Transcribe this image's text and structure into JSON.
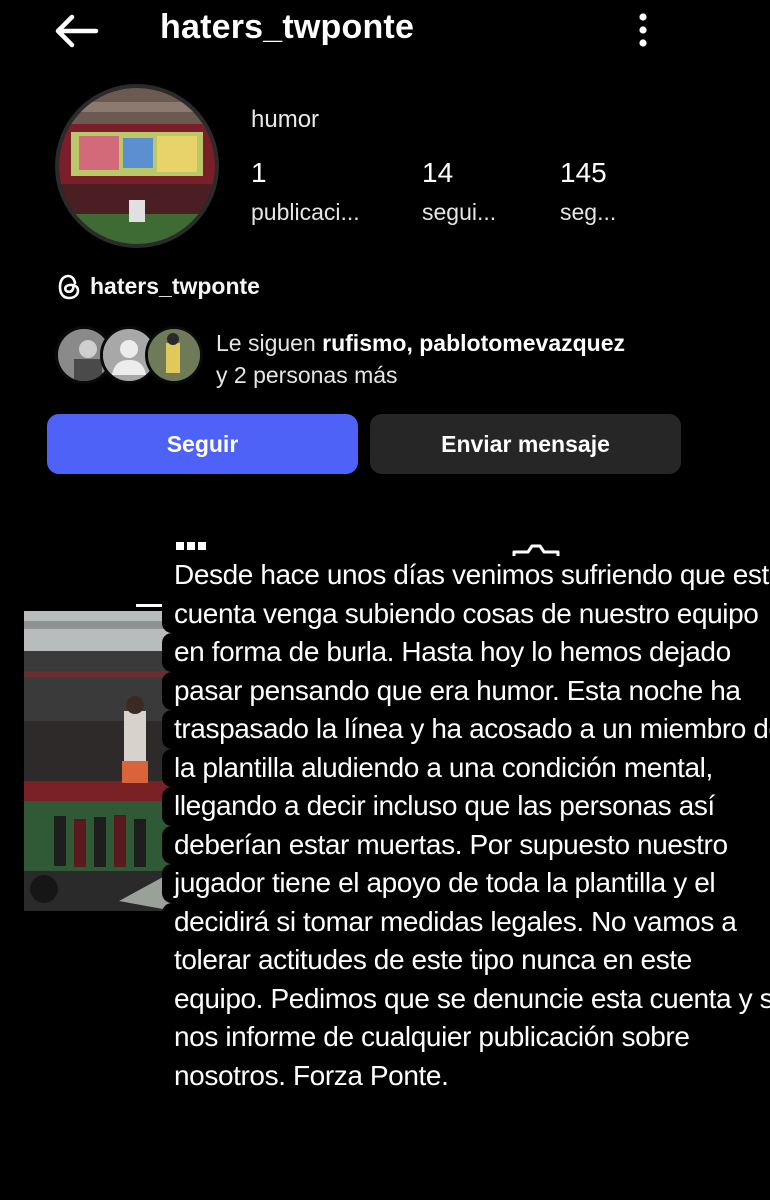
{
  "header": {
    "username": "haters_twponte"
  },
  "profile": {
    "category": "humor",
    "stats": [
      {
        "value": "1",
        "label": "publicaci..."
      },
      {
        "value": "14",
        "label": "segui..."
      },
      {
        "value": "145",
        "label": "seg..."
      }
    ],
    "threads_handle": "haters_twponte"
  },
  "followed_by": {
    "prefix": "Le siguen ",
    "names": "rufismo, pablotomevazquez",
    "suffix": "y 2 personas más"
  },
  "actions": {
    "follow_label": "Seguir",
    "message_label": "Enviar mensaje"
  },
  "overlay_text": {
    "lines": [
      "Desde hace unos días venimos sufriendo que esta",
      "cuenta venga subiendo cosas de nuestro equipo",
      "en forma de burla. Hasta hoy lo hemos dejado",
      "pasar pensando que era humor. Esta noche ha",
      "traspasado la línea y ha acosado a un miembro de",
      "la plantilla aludiendo a una condición mental,",
      "llegando a decir incluso que las personas así",
      "deberían estar muertas. Por supuesto nuestro",
      "jugador tiene el apoyo de toda la plantilla y el",
      "decidirá si tomar medidas legales. No vamos a",
      "tolerar actitudes de este tipo nunca en este",
      "equipo. Pedimos que se denuncie esta cuenta y se",
      "nos informe de cualquier publicación  sobre",
      "nosotros. Forza Ponte."
    ]
  },
  "colors": {
    "background": "#000000",
    "follow_button": "#4f62f7",
    "secondary_button": "#262626",
    "text": "#f5f5f5"
  },
  "icons": [
    "back-arrow-icon",
    "more-vertical-icon",
    "threads-icon",
    "grid-icon",
    "tagged-icon"
  ]
}
